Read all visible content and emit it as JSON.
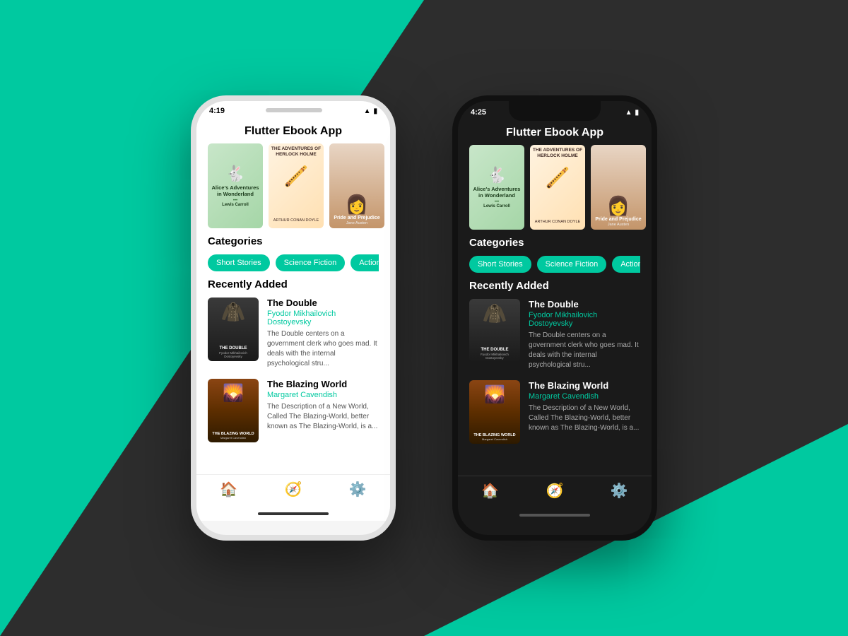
{
  "background": {
    "color_teal": "#00c9a0",
    "color_dark": "#2d2d2d"
  },
  "phone_light": {
    "time": "4:19",
    "theme": "light",
    "header_title": "Flutter Ebook App",
    "books_featured": [
      {
        "title": "Alice's Adventures in Wonderland",
        "author": "Lewis Carroll",
        "emoji": "🐇"
      },
      {
        "title": "THE ADVENTURES OF SHERLOCK HOLMES",
        "author": "ARTHUR CONAN DOYLE",
        "emoji": "🪈"
      },
      {
        "title": "Pride and Prejudice",
        "author": "Jane Austen",
        "emoji": "👩"
      }
    ],
    "categories_title": "Categories",
    "categories": [
      "Short Stories",
      "Science Fiction",
      "Action & Adventure"
    ],
    "recently_added_title": "Recently Added",
    "books_recent": [
      {
        "title": "The Double",
        "author": "Fyodor Mikhailovich Dostoyevsky",
        "desc": "The Double centers on a government clerk who goes mad. It deals with the internal psychological stru...",
        "emoji": "🧥"
      },
      {
        "title": "The Blazing World",
        "author": "Margaret Cavendish",
        "desc": "The Description of a New World, Called The Blazing-World, better known as The Blazing-World, is a...",
        "emoji": "🌄"
      }
    ],
    "nav": [
      "🏠",
      "🧭",
      "⚙️"
    ]
  },
  "phone_dark": {
    "time": "4:25",
    "theme": "dark",
    "header_title": "Flutter Ebook App",
    "books_featured": [
      {
        "title": "Alice's Adventures in Wonderland",
        "author": "Lewis Carroll",
        "emoji": "🐇"
      },
      {
        "title": "THE ADVENTURES OF SHERLOCK HOLMES",
        "author": "ARTHUR CONAN DOYLE",
        "emoji": "🪈"
      },
      {
        "title": "Pride and Prejudice",
        "author": "Jane Austen",
        "emoji": "👩"
      }
    ],
    "categories_title": "Categories",
    "categories": [
      "Short Stories",
      "Science Fiction",
      "Action & Adventure"
    ],
    "recently_added_title": "Recently Added",
    "books_recent": [
      {
        "title": "The Double",
        "author": "Fyodor Mikhailovich Dostoyevsky",
        "desc": "The Double centers on a government clerk who goes mad. It deals with the internal psychological stru...",
        "emoji": "🧥"
      },
      {
        "title": "The Blazing World",
        "author": "Margaret Cavendish",
        "desc": "The Description of a New World, Called The Blazing-World, better known as The Blazing-World, is a...",
        "emoji": "🌄"
      }
    ],
    "nav": [
      "🏠",
      "🧭",
      "⚙️"
    ]
  }
}
